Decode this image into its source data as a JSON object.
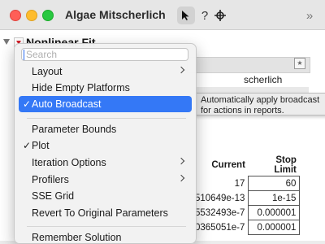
{
  "window": {
    "title": "Algae Mitscherlich"
  },
  "report": {
    "outline_title": "Nonlinear Fit",
    "behind_text": "scherlich",
    "table": {
      "headers": {
        "current": "Current",
        "stop_limit": "Stop Limit"
      },
      "rows": [
        {
          "current": "17",
          "stop_limit": "60"
        },
        {
          "current": "510649e-13",
          "stop_limit": "1e-15"
        },
        {
          "current": "5532493e-7",
          "stop_limit": "0.000001"
        },
        {
          "current": "0365051e-7",
          "stop_limit": "0.000001"
        }
      ]
    }
  },
  "tooltip": {
    "text": "Automatically apply broadcast for actions in reports."
  },
  "menu": {
    "search_placeholder": "Search",
    "items": [
      {
        "label": "Layout",
        "submenu": true,
        "checked": false
      },
      {
        "label": "Hide Empty Platforms",
        "submenu": false,
        "checked": false
      },
      {
        "label": "Auto Broadcast",
        "submenu": false,
        "checked": true,
        "highlighted": true
      },
      {
        "label": "Parameter Bounds",
        "submenu": false,
        "checked": false
      },
      {
        "label": "Plot",
        "submenu": false,
        "checked": true
      },
      {
        "label": "Iteration Options",
        "submenu": true,
        "checked": false
      },
      {
        "label": "Profilers",
        "submenu": true,
        "checked": false
      },
      {
        "label": "SSE Grid",
        "submenu": false,
        "checked": false
      },
      {
        "label": "Revert To Original Parameters",
        "submenu": false,
        "checked": false
      },
      {
        "label": "Remember Solution",
        "submenu": false,
        "checked": false
      }
    ],
    "check_glyph": "✓"
  },
  "toolbar": {
    "help_glyph": "?",
    "more_glyph": "»"
  },
  "colors": {
    "highlight": "#3478f6",
    "red_triangle": "#d3202a"
  }
}
